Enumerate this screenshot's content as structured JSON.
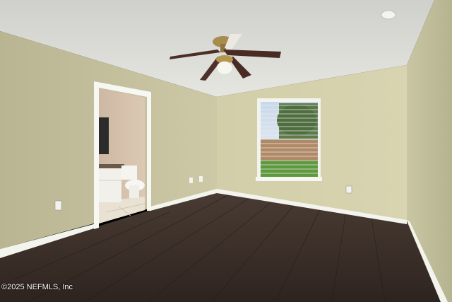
{
  "watermark": {
    "text": "©2025 NEFMLS, Inc"
  }
}
